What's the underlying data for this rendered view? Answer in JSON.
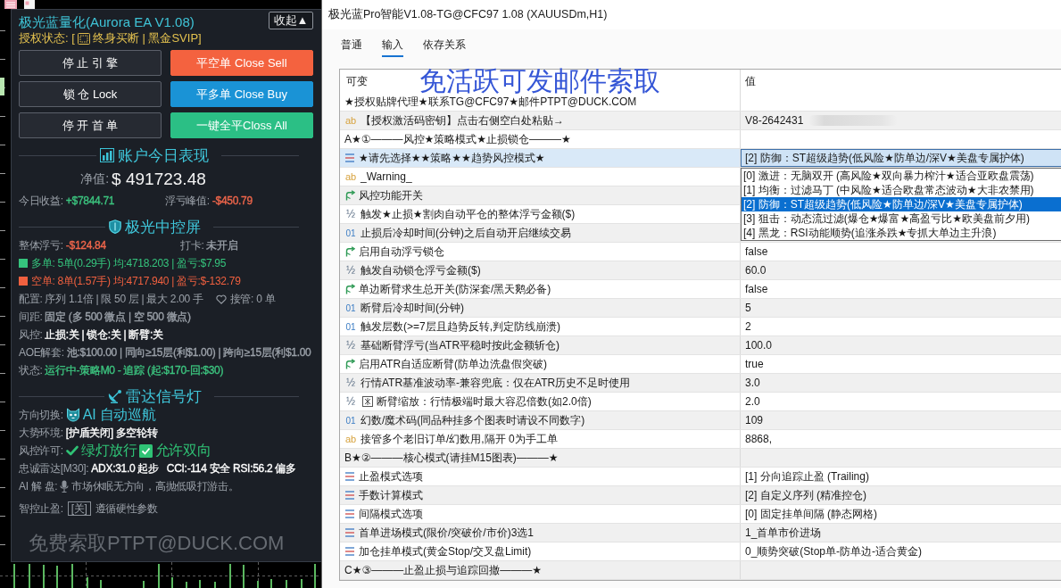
{
  "chart_window": {
    "ea_panel": {
      "title": "极光蓝量化(Aurora EA V1.08)",
      "collapse_button": "收起▲",
      "license": {
        "before": "授权状态: [",
        "after": "终身买断 | 黑金SVIP]"
      },
      "buttons": [
        {
          "label": "停 止 引 擎",
          "color": "#262a32"
        },
        {
          "label": "平空单 Close Sell",
          "color": "#f4623f"
        },
        {
          "label": "锁 仓 Lock",
          "color": "#262a32"
        },
        {
          "label": "平多单 Close Buy",
          "color": "#1a93d6"
        },
        {
          "label": "停 开 首 单",
          "color": "#262a32"
        },
        {
          "label": "一键全平Closs All",
          "color": "#2bbf85"
        }
      ],
      "sections": [
        {
          "kind": "account",
          "title": "账户今日表现",
          "lines": [
            {
              "kind": "equity",
              "label": "净值:",
              "value": "$ 491723.48"
            },
            {
              "kind": "pair",
              "items": [
                {
                  "label": "今日收益:",
                  "value": "+$7844.71",
                  "color": "#3cc47f"
                },
                {
                  "label": "浮亏峰值:",
                  "value": "-$450.79",
                  "color": "#f0664b"
                }
              ]
            }
          ]
        },
        {
          "kind": "control",
          "title": "极光中控屏",
          "lines": [
            {
              "kind": "pair",
              "items": [
                {
                  "label": "整体浮亏:",
                  "value": "-$124.84",
                  "color": "#f0664b"
                },
                {
                  "label": "打卡:",
                  "value": "未开启",
                  "color": "#9ba1a9"
                }
              ]
            },
            {
              "kind": "position",
              "color": "#35c47d",
              "text": "多单: 5单(0.29手) 均:4718.203 | 盈亏:$7.95"
            },
            {
              "kind": "position",
              "color": "#f0603f",
              "text": "空单: 8单(1.57手) 均:4717.940 | 盈亏:$-132.79"
            },
            {
              "kind": "config",
              "text": "配置: 序列 1.1倍 | 限 50 层 | 最大 2.00 手",
              "extra": "接管: 0 单"
            },
            {
              "kind": "plain",
              "label": "间距:",
              "value": "固定 (多 500 微点 | 空 500 微点)",
              "color": "#9ba1a9"
            },
            {
              "kind": "plain",
              "label": "风控:",
              "value": "止损:关 | 锁仓:关 | 断臂:关",
              "color": "#ffffff"
            },
            {
              "kind": "plain",
              "label": "AOE解套:",
              "value": "池:$100.00 | 同向≥15层(利$1.00) | 跨向≥15层(利$1.00",
              "color": "#9ba1a9"
            },
            {
              "kind": "plain",
              "label": "状态:",
              "value": "运行中-策略M0 - 追踪 (起:$170-回:$30)",
              "color": "#3cc47f"
            }
          ]
        },
        {
          "kind": "radar",
          "title": "雷达信号灯",
          "lines": [
            {
              "kind": "mode",
              "label": "方向切换:",
              "value": "AI 自动巡航"
            },
            {
              "kind": "plain",
              "label": "大势环境:",
              "value": "[护盾关闭] 多空轮转",
              "color": "#ffffff"
            },
            {
              "kind": "permits",
              "label": "风控许可:",
              "items": [
                {
                  "kind": "tick",
                  "text": "绿灯放行"
                },
                {
                  "kind": "checkbox",
                  "text": "允许双向",
                  "checked": true
                }
              ]
            },
            {
              "kind": "plain",
              "label": "忠诚雷达[M30]:",
              "value": "ADX:31.0 起步   CCI:-114 安全 RSI:56.2 偏多",
              "color": "#ffffff"
            },
            {
              "kind": "commentary",
              "label": "AI 解 盘:",
              "value": "市场休眠无方向，高抛低吸打游击。"
            },
            {
              "kind": "tag",
              "label": "智控止盈:",
              "tag": "[关]",
              "value": "遵循硬性参数"
            }
          ]
        }
      ],
      "footer": "免费索取PTPT@DUCK.COM"
    }
  },
  "settings_dialog": {
    "title": "极光蓝Pro智能V1.08-TG@CFC97 1.08 (XAUUSDm,H1)",
    "tabs": [
      {
        "label": "普通",
        "selected": false
      },
      {
        "label": "输入",
        "selected": true
      },
      {
        "label": "依存关系",
        "selected": false
      }
    ],
    "annotation": "免活跃可发邮件索取",
    "table": {
      "columns": [
        "可变",
        "值"
      ],
      "rows": [
        {
          "kind": "note",
          "name": "★授权贴牌代理★联系TG@CFC97★邮件PTPT@DUCK.COM",
          "selected": false
        },
        {
          "kind": "string",
          "tag": "ab",
          "name": "【授权激活码密钥】点击右侧空白处粘贴→",
          "value": "V8-2642431",
          "redacted": true,
          "selected": false
        },
        {
          "kind": "note",
          "name": "A★①———风控★策略模式★止损锁仓———★",
          "selected": false
        },
        {
          "kind": "enum",
          "name": "★请先选择★★策略★★趋势风控模式★",
          "value": "[2] 防御：ST超级趋势(低风险★防单边/深V★美盘专属护体)",
          "expanded": true,
          "selected": true,
          "options": [
            {
              "label": "[0] 激进：无脑双开 (高风险★双向暴力榨汁★适合亚欧盘震荡)",
              "selected": false
            },
            {
              "label": "[1] 均衡：过滤马丁 (中风险★适合欧盘常态波动★大非农禁用)",
              "selected": false
            },
            {
              "label": "[2] 防御：ST超级趋势(低风险★防单边/深V★美盘专属护体)",
              "selected": true
            },
            {
              "label": "[3] 狙击：动态流过滤(爆仓★爆富★高盈亏比★欧美盘前夕用)",
              "selected": false
            },
            {
              "label": "[4] 黑龙：RSI动能顺势(追涨杀跌★专抓大单边主升浪)",
              "selected": false
            }
          ]
        },
        {
          "kind": "string",
          "tag": "ab",
          "name": "_Warning_",
          "selected": false
        },
        {
          "kind": "bool",
          "name": "风控功能开关",
          "selected": false
        },
        {
          "kind": "double",
          "tag": "½",
          "name": "触发★止损★割肉自动平仓的整体浮亏金额($)",
          "selected": false
        },
        {
          "kind": "integer",
          "tag": "01",
          "name": "止损后冷却时间(分钟)之后自动开启继续交易",
          "selected": false
        },
        {
          "kind": "bool",
          "name": "启用自动浮亏锁仓",
          "value": "false",
          "selected": false
        },
        {
          "kind": "double",
          "tag": "½",
          "name": "触发自动锁仓浮亏金额($)",
          "value": "60.0",
          "selected": false
        },
        {
          "kind": "bool",
          "name": "单边断臂求生总开关(防深套/黑天鹅必备)",
          "value": "false",
          "selected": false
        },
        {
          "kind": "integer",
          "tag": "01",
          "name": "断臂后冷却时间(分钟)",
          "value": "5",
          "selected": false
        },
        {
          "kind": "integer",
          "tag": "01",
          "name": "触发层数(>=7层且趋势反转,判定防线崩溃)",
          "value": "2",
          "selected": false
        },
        {
          "kind": "double",
          "tag": "½",
          "name": "基础断臂浮亏(当ATR平稳时按此金额斩仓)",
          "value": "100.0",
          "selected": false
        },
        {
          "kind": "bool",
          "name": "启用ATR自适应断臂(防单边洗盘假突破)",
          "value": "true",
          "selected": false
        },
        {
          "kind": "double",
          "tag": "½",
          "name": "行情ATR基准波动率-兼容兜底：仅在ATR历史不足时使用",
          "value": "3.0",
          "selected": false
        },
        {
          "kind": "double",
          "tag": "½",
          "glyph": true,
          "name": "断臂缩放：行情极端时最大容忍倍数(如2.0倍)",
          "value": "2.0",
          "selected": false
        },
        {
          "kind": "integer",
          "tag": "01",
          "name": "幻数/魔术码(同品种挂多个图表时请设不同数字)",
          "value": "109",
          "selected": false
        },
        {
          "kind": "string",
          "tag": "ab",
          "name": "接管多个老旧订单/幻数用,隔开 0为手工单",
          "value": "8868,",
          "selected": false
        },
        {
          "kind": "note",
          "name": "B★②———核心模式(请挂M15图表)———★",
          "selected": false
        },
        {
          "kind": "enum",
          "name": "止盈模式选项",
          "value": "[1] 分向追踪止盈 (Trailing)",
          "expanded": false,
          "selected": false
        },
        {
          "kind": "enum",
          "name": "手数计算模式",
          "value": "[2] 自定义序列 (精准控仓)",
          "expanded": false,
          "selected": false
        },
        {
          "kind": "enum",
          "name": "间隔模式选项",
          "value": "[0] 固定挂单间隔 (静态网格)",
          "expanded": false,
          "selected": false
        },
        {
          "kind": "enum",
          "name": "首单进场模式(限价/突破价/市价)3选1",
          "value": "1_首单市价进场",
          "expanded": false,
          "selected": false
        },
        {
          "kind": "enum",
          "name": "加仓挂单模式(黄金Stop/交叉盘Limit)",
          "value": "0_顺势突破(Stop单-防单边-适合黄金)",
          "expanded": false,
          "selected": false
        },
        {
          "kind": "note",
          "name": "C★③———止盈止损与追踪回撤———★",
          "selected": false
        }
      ]
    }
  }
}
